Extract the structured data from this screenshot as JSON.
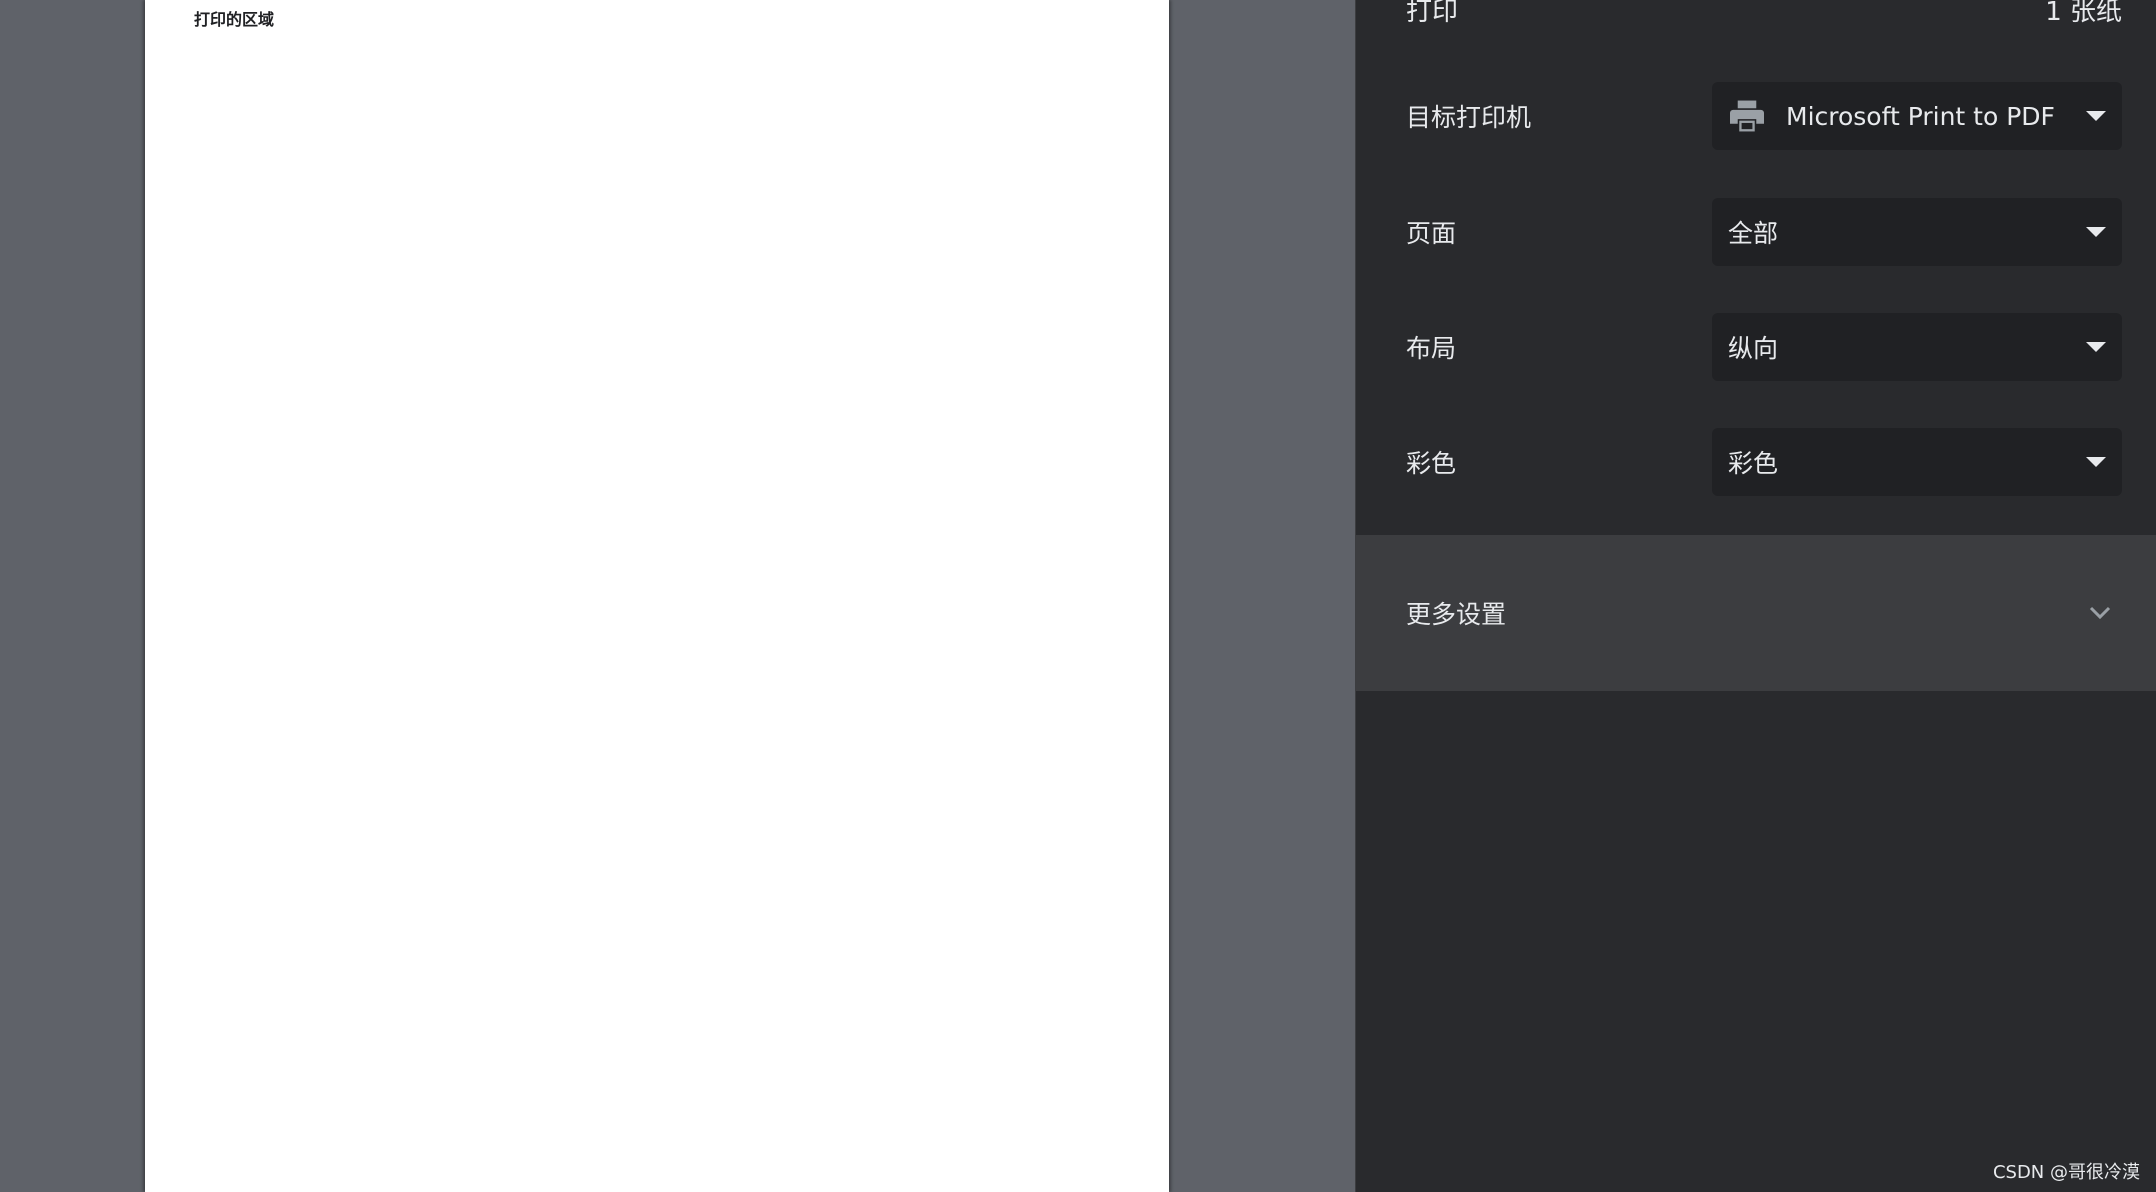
{
  "preview": {
    "page_text": "打印的区域"
  },
  "panel": {
    "title": "打印",
    "sheet_count": "1 张纸"
  },
  "settings": {
    "destination": {
      "label": "目标打印机",
      "value": "Microsoft Print to PDF",
      "icon": "printer-icon"
    },
    "pages": {
      "label": "页面",
      "value": "全部"
    },
    "layout": {
      "label": "布局",
      "value": "纵向"
    },
    "color": {
      "label": "彩色",
      "value": "彩色"
    }
  },
  "more_settings": {
    "label": "更多设置",
    "icon": "chevron-down-icon"
  },
  "watermark": "CSDN @哥很冷漠",
  "colors": {
    "preview_background": "#5f6269",
    "panel_background": "#292a2d",
    "select_background": "#202124",
    "more_settings_background": "#3c3d40",
    "text": "#e8eaed"
  }
}
